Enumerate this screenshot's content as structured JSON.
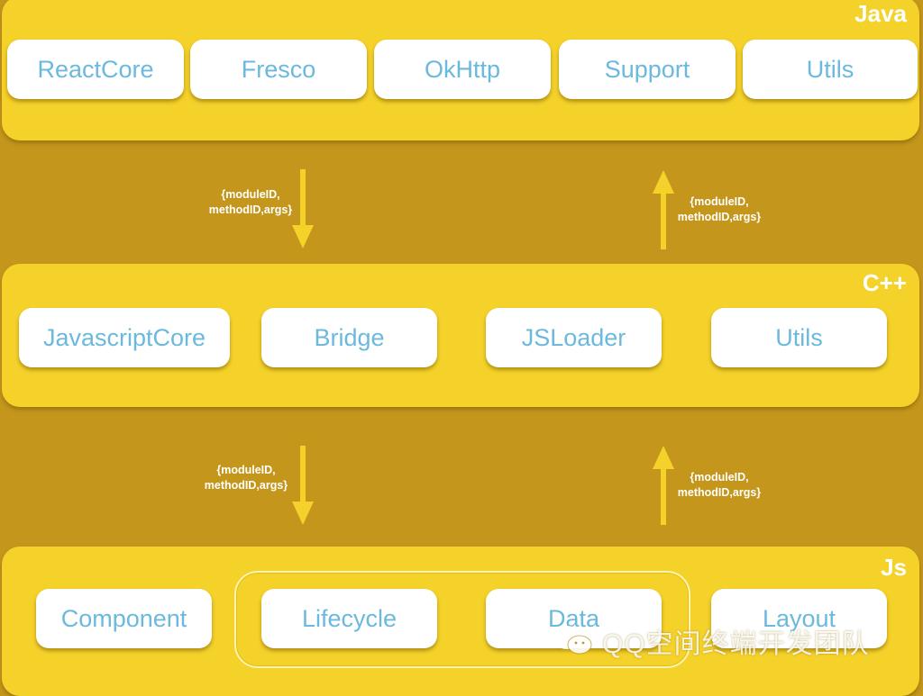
{
  "layers": {
    "java": {
      "title": "Java",
      "modules": [
        "ReactCore",
        "Fresco",
        "OkHttp",
        "Support",
        "Utils"
      ]
    },
    "cpp": {
      "title": "C++",
      "modules": [
        "JavascriptCore",
        "Bridge",
        "JSLoader",
        "Utils"
      ]
    },
    "js": {
      "title": "Js",
      "modules": [
        "Component",
        "Lifecycle",
        "Data",
        "Layout"
      ]
    }
  },
  "arrows": {
    "java_to_cpp": {
      "direction": "down",
      "label_line1": "{moduleID,",
      "label_line2": "methodID,args}"
    },
    "cpp_to_java": {
      "direction": "up",
      "label_line1": "{moduleID,",
      "label_line2": "methodID,args}"
    },
    "cpp_to_js": {
      "direction": "down",
      "label_line1": "{moduleID,",
      "label_line2": "methodID,args}"
    },
    "js_to_cpp": {
      "direction": "up",
      "label_line1": "{moduleID,",
      "label_line2": "methodID,args}"
    }
  },
  "watermark": {
    "icon": "wechat-icon",
    "text": "QQ空间终端开发团队"
  },
  "colors": {
    "background": "#c4961c",
    "layer": "#f5d22a",
    "module_text": "#6cb9de",
    "arrow": "#f5d22a"
  }
}
